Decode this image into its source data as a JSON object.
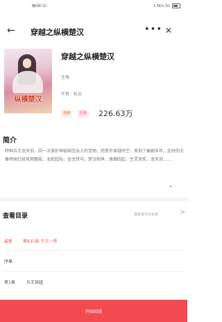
{
  "status_bar": {
    "time": "晚间6:32",
    "signal_text": "1.5K/s 5G"
  },
  "nav": {
    "back_glyph": "←",
    "title": "穿越之纵横楚汉",
    "more_glyph": "•••",
    "close_glyph": "✕"
  },
  "book": {
    "cover_text": "纵横楚汉",
    "name": "穿越之纵横楚汉",
    "role": "主角:",
    "author": "作者：松云",
    "tags": [
      "完结",
      "历史"
    ],
    "word_count": "226.63万"
  },
  "intro": {
    "heading": "简介",
    "text": "特种兵王龙天羽，因一次保护神秘国宝出土的宝物，而意外穿越时空，来到了秦朝末年，此时的大秦帝国已经风雨飘摇，龙蛇起陆，金戈铁马，楚汉相争，烽烟四起，生灵涂炭，龙天羽……",
    "expand_glyph": "⌄"
  },
  "toc": {
    "heading": "查看目录",
    "status": "最新章节共多章",
    "arrow_glyph": ">",
    "latest_label": "最新",
    "latest_chapter": "第835章  千古一帝",
    "preface": "序章",
    "chapter1_number": "第1章",
    "chapter1_title": "兵王穿越"
  },
  "read_button": {
    "label": "开始阅读"
  },
  "colors": {
    "accent": "#f24a4f",
    "link": "#4a78d6"
  }
}
